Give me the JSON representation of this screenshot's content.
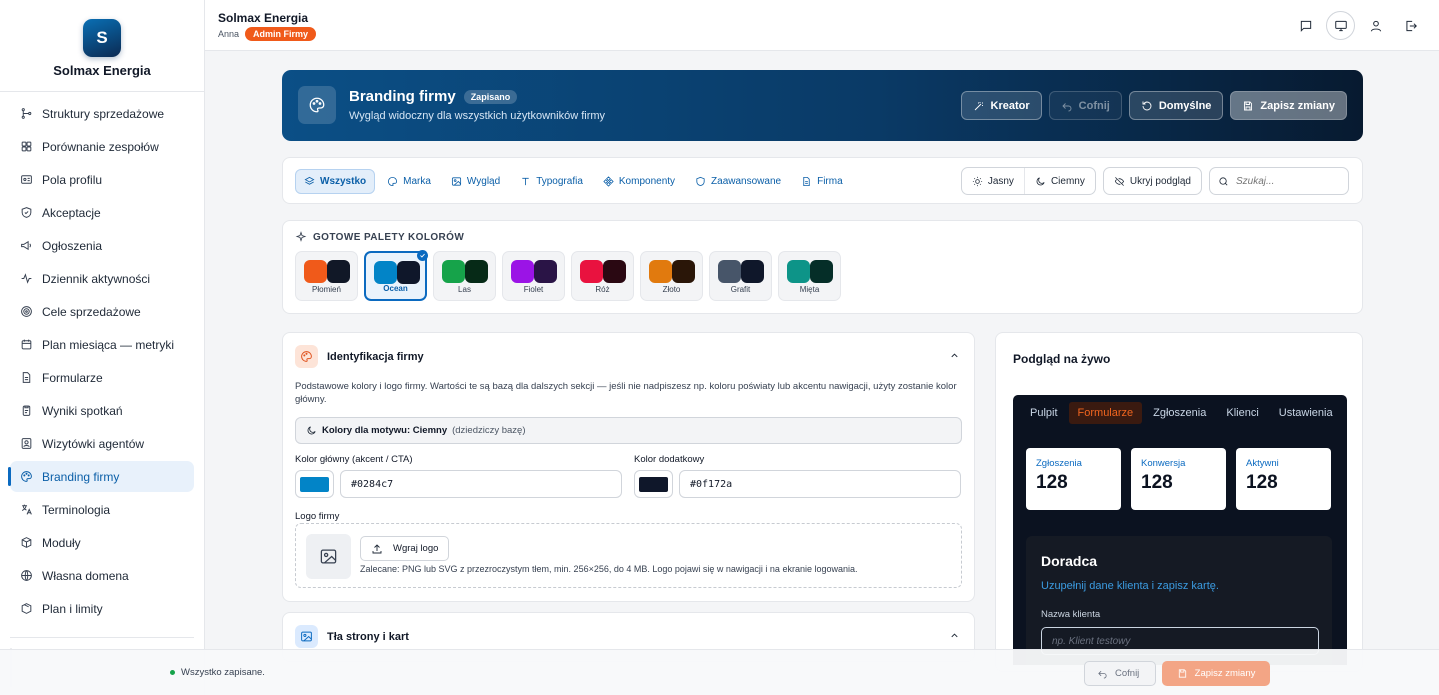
{
  "brand": {
    "logo_letter": "S",
    "name": "Solmax Energia"
  },
  "sidebar": {
    "items": [
      {
        "label": "Struktury sprzedażowe",
        "icon": "hierarchy-icon"
      },
      {
        "label": "Porównanie zespołów",
        "icon": "grid-icon"
      },
      {
        "label": "Pola profilu",
        "icon": "id-card-icon"
      },
      {
        "label": "Akceptacje",
        "icon": "shield-check-icon"
      },
      {
        "label": "Ogłoszenia",
        "icon": "megaphone-icon"
      },
      {
        "label": "Dziennik aktywności",
        "icon": "activity-icon"
      },
      {
        "label": "Cele sprzedażowe",
        "icon": "target-icon"
      },
      {
        "label": "Plan miesiąca — metryki",
        "icon": "calendar-icon"
      },
      {
        "label": "Formularze",
        "icon": "document-icon"
      },
      {
        "label": "Wyniki spotkań",
        "icon": "clipboard-icon"
      },
      {
        "label": "Wizytówki agentów",
        "icon": "contact-icon"
      },
      {
        "label": "Branding firmy",
        "icon": "palette-icon",
        "active": true
      },
      {
        "label": "Terminologia",
        "icon": "translate-icon"
      },
      {
        "label": "Moduły",
        "icon": "box-icon"
      },
      {
        "label": "Własna domena",
        "icon": "globe-icon"
      },
      {
        "label": "Plan i limity",
        "icon": "package-icon"
      }
    ]
  },
  "topbar": {
    "company": "Solmax Energia",
    "user": "Anna",
    "role_badge": "Admin Firmy"
  },
  "hero": {
    "title": "Branding firmy",
    "saved_pill": "Zapisano",
    "subtitle": "Wygląd widoczny dla wszystkich użytkowników firmy",
    "buttons": {
      "creator": "Kreator",
      "undo": "Cofnij",
      "defaults": "Domyślne",
      "save": "Zapisz zmiany"
    }
  },
  "toolbar": {
    "tabs": [
      "Wszystko",
      "Marka",
      "Wygląd",
      "Typografia",
      "Komponenty",
      "Zaawansowane",
      "Firma"
    ],
    "theme_light": "Jasny",
    "theme_dark": "Ciemny",
    "hide_preview": "Ukryj podgląd",
    "search_placeholder": "Szukaj..."
  },
  "palettes": {
    "heading": "GOTOWE PALETY KOLORÓW",
    "items": [
      {
        "name": "Płomień",
        "a": "#f05a1a",
        "b": "#111827"
      },
      {
        "name": "Ocean",
        "a": "#0284c7",
        "b": "#0f172a",
        "selected": true
      },
      {
        "name": "Las",
        "a": "#16a34a",
        "b": "#062a17"
      },
      {
        "name": "Fiolet",
        "a": "#9b14e6",
        "b": "#2a1446"
      },
      {
        "name": "Róż",
        "a": "#e9123f",
        "b": "#2a0812"
      },
      {
        "name": "Złoto",
        "a": "#e17a0e",
        "b": "#2a1608"
      },
      {
        "name": "Grafit",
        "a": "#475569",
        "b": "#0f172a"
      },
      {
        "name": "Mięta",
        "a": "#0d9488",
        "b": "#052e28"
      }
    ]
  },
  "identity": {
    "title": "Identyfikacja firmy",
    "description": "Podstawowe kolory i logo firmy. Wartości te są bazą dla dalszych sekcji — jeśli nie nadpiszesz np. koloru poświaty lub akcentu nawigacji, użyty zostanie kolor główny.",
    "motif_label": "Kolory dla motywu: Ciemny",
    "motif_note": "(dziedziczy bazę)",
    "primary_label": "Kolor główny (akcent / CTA)",
    "primary_value": "#0284c7",
    "secondary_label": "Kolor dodatkowy",
    "secondary_value": "#0f172a",
    "logo_label": "Logo firmy",
    "upload_button": "Wgraj logo",
    "logo_hint": "Zalecane: PNG lub SVG z przezroczystym tłem, min. 256×256, do 4 MB. Logo pojawi się w nawigacji i na ekranie logowania."
  },
  "backgrounds": {
    "title": "Tła strony i kart"
  },
  "preview": {
    "title": "Podgląd na żywo",
    "tabs": [
      "Pulpit",
      "Formularze",
      "Zgłoszenia",
      "Klienci",
      "Ustawienia"
    ],
    "stats": [
      {
        "label": "Zgłoszenia",
        "value": "128"
      },
      {
        "label": "Konwersja",
        "value": "128"
      },
      {
        "label": "Aktywni",
        "value": "128"
      }
    ],
    "panel_title": "Doradca",
    "panel_sub": "Uzupełnij dane klienta i zapisz kartę.",
    "field_label": "Nazwa klienta",
    "field_placeholder": "np. Klient testowy"
  },
  "statusbar": {
    "message": "Wszystko zapisane.",
    "undo": "Cofnij",
    "save": "Zapisz zmiany"
  }
}
